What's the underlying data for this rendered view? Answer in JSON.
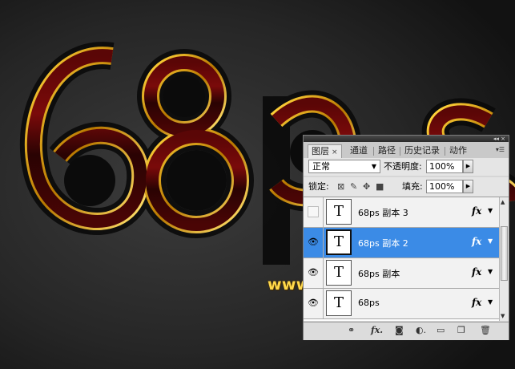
{
  "artwork": {
    "big_text": "68ps",
    "watermark": "www.68ps.com"
  },
  "panel": {
    "tabs": [
      {
        "label": "图层",
        "active": true
      },
      {
        "label": "通道",
        "active": false
      },
      {
        "label": "路径",
        "active": false
      },
      {
        "label": "历史记录",
        "active": false
      },
      {
        "label": "动作",
        "active": false
      }
    ],
    "tab_close": "×",
    "blend_mode": "正常",
    "opacity_label": "不透明度:",
    "opacity_value": "100%",
    "lock_label": "锁定:",
    "fill_label": "填充:",
    "fill_value": "100%",
    "layers": [
      {
        "name": "68ps  副本 3",
        "visible": false,
        "selected": false,
        "thumb": "T",
        "fx": "fx"
      },
      {
        "name": "68ps  副本 2",
        "visible": true,
        "selected": true,
        "thumb": "T",
        "fx": "fx"
      },
      {
        "name": "68ps  副本",
        "visible": true,
        "selected": false,
        "thumb": "T",
        "fx": "fx"
      },
      {
        "name": "68ps",
        "visible": true,
        "selected": false,
        "thumb": "T",
        "fx": "fx"
      }
    ],
    "colors": {
      "selected": "#3b8be6",
      "panel_bg": "#d6d6d6",
      "watermark": "#ffd84a"
    },
    "bottom_icons": [
      "link-icon",
      "fx-icon",
      "mask-icon",
      "adjustment-icon",
      "group-icon",
      "new-layer-icon",
      "trash-icon"
    ]
  }
}
